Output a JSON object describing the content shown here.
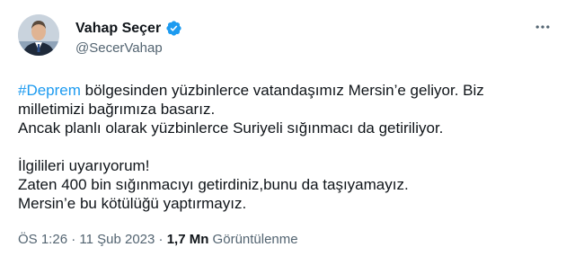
{
  "author": {
    "name": "Vahap Seçer",
    "handle": "@SecerVahap"
  },
  "tweet": {
    "hashtag": "#Deprem",
    "line1_rest": " bölgesinden yüzbinlerce vatandaşımız Mersin’e geliyor. Biz",
    "line2": "milletimizi bağrımıza basarız.",
    "line3": "Ancak planlı olarak yüzbinlerce Suriyeli sığınmacı da getiriliyor.",
    "line4": "İlgilileri uyarıyorum!",
    "line5": "Zaten 400 bin sığınmacıyı getirdiniz,bunu da taşıyamayız.",
    "line6": "Mersin’e bu kötülüğü yaptırmayız."
  },
  "meta": {
    "time": "ÖS 1:26",
    "dot1": " · ",
    "date": "11 Şub 2023",
    "dot2": " · ",
    "views_count": "1,7 Mn",
    "views_label": " Görüntülenme"
  },
  "colors": {
    "accent": "#1d9bf0",
    "text": "#0f1419",
    "secondary": "#536471"
  }
}
